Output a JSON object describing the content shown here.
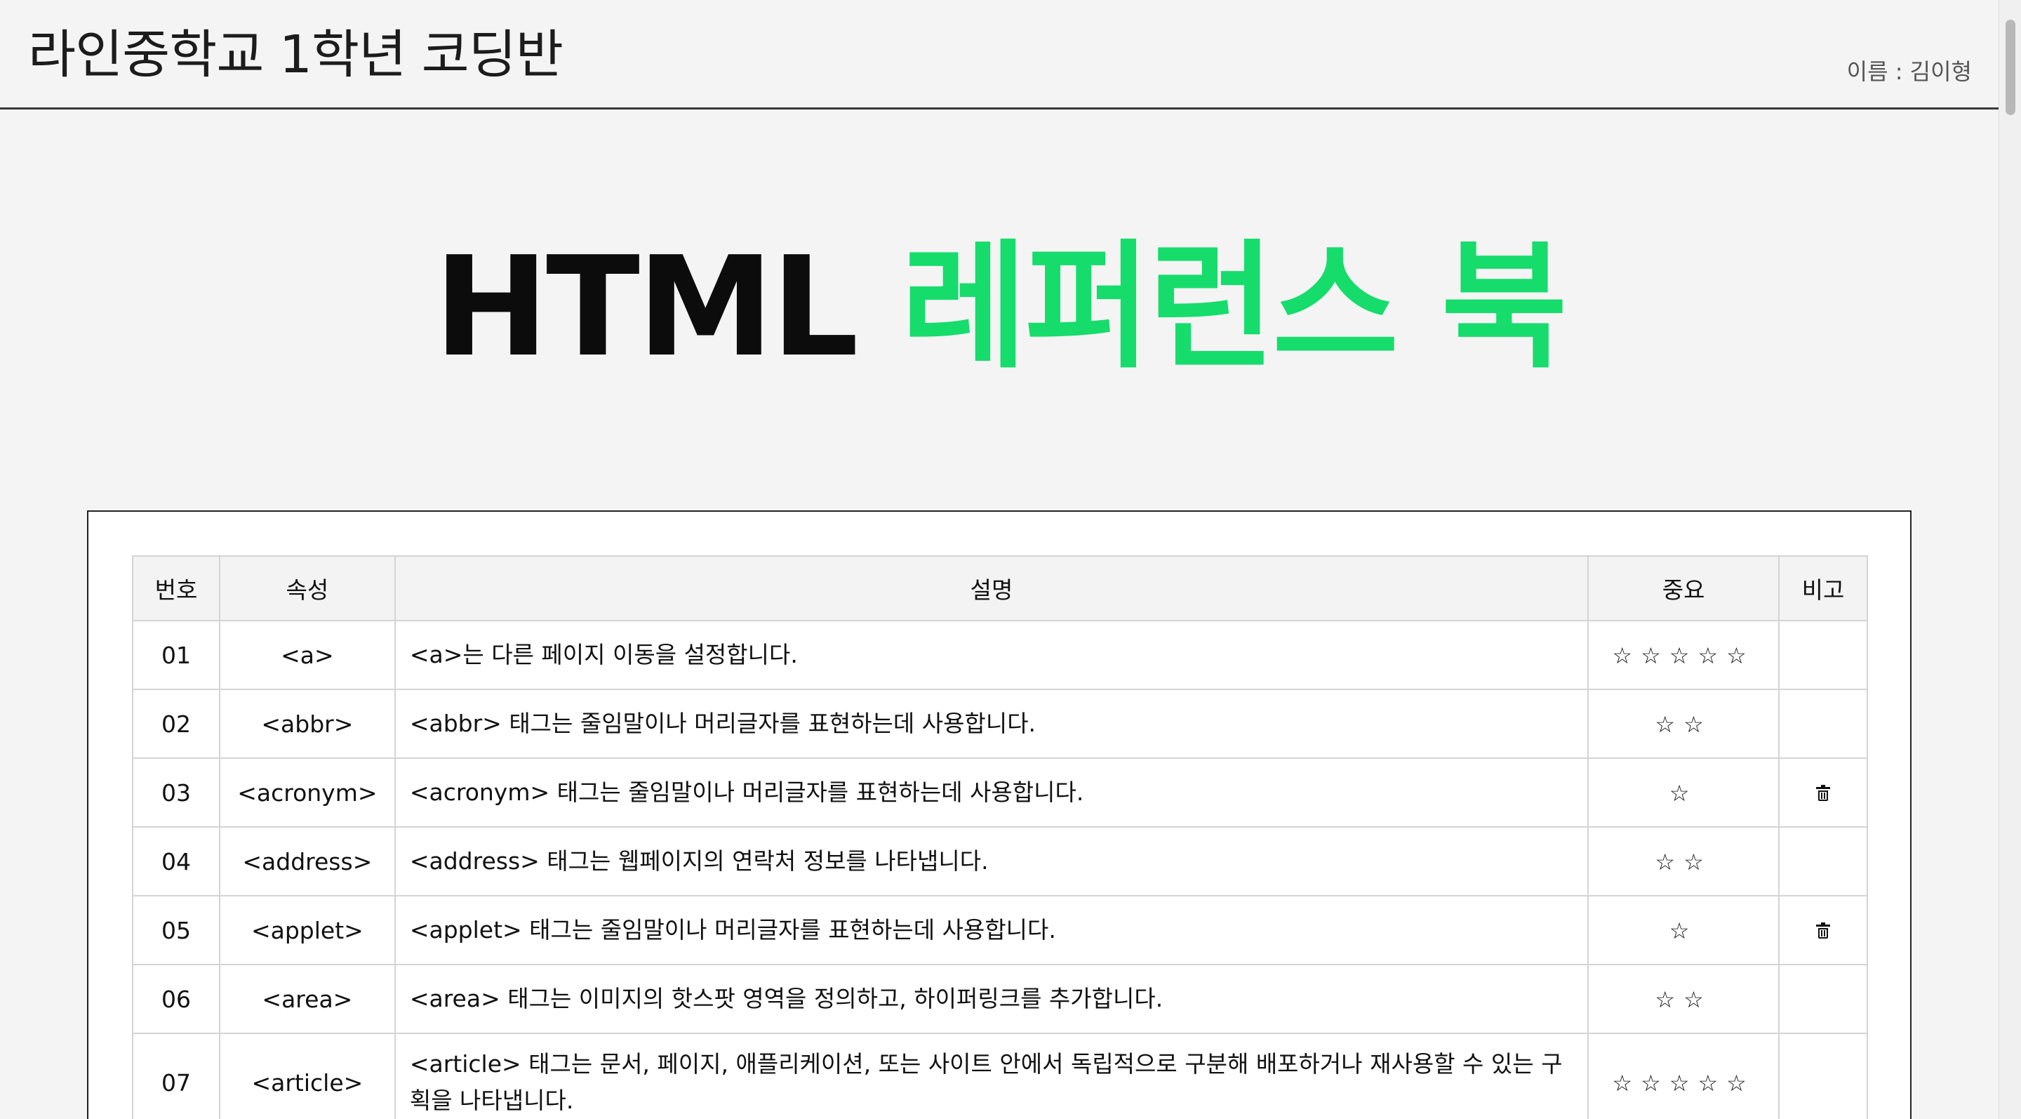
{
  "header": {
    "title": "라인중학교 1학년 코딩반",
    "user": "이름 : 김이형"
  },
  "hero": {
    "title_black": "HTML",
    "title_green": "레퍼런스 북",
    "accent_color": "#16dc6c"
  },
  "table": {
    "headers": {
      "no": "번호",
      "attr": "속성",
      "desc": "설명",
      "importance": "중요",
      "note": "비고"
    },
    "rows": [
      {
        "no": "01",
        "attr": "<a>",
        "desc": "<a>는 다른 페이지 이동을 설정합니다.",
        "stars": "☆☆☆☆☆",
        "note_icon": ""
      },
      {
        "no": "02",
        "attr": "<abbr>",
        "desc": "<abbr> 태그는 줄임말이나 머리글자를 표현하는데 사용합니다.",
        "stars": "☆☆",
        "note_icon": ""
      },
      {
        "no": "03",
        "attr": "<acronym>",
        "desc": "<acronym> 태그는 줄임말이나 머리글자를 표현하는데 사용합니다.",
        "stars": "☆",
        "note_icon": "trash-icon"
      },
      {
        "no": "04",
        "attr": "<address>",
        "desc": "<address> 태그는 웹페이지의 연락처 정보를 나타냅니다.",
        "stars": "☆☆",
        "note_icon": ""
      },
      {
        "no": "05",
        "attr": "<applet>",
        "desc": "<applet> 태그는 줄임말이나 머리글자를 표현하는데 사용합니다.",
        "stars": "☆",
        "note_icon": "trash-icon"
      },
      {
        "no": "06",
        "attr": "<area>",
        "desc": "<area> 태그는 이미지의 핫스팟 영역을 정의하고, 하이퍼링크를 추가합니다.",
        "stars": "☆☆",
        "note_icon": ""
      },
      {
        "no": "07",
        "attr": "<article>",
        "desc": "<article> 태그는 문서, 페이지, 애플리케이션, 또는 사이트 안에서 독립적으로 구분해 배포하거나 재사용할 수 있는 구획을 나타냅니다.",
        "stars": "☆☆☆☆☆",
        "note_icon": ""
      }
    ]
  }
}
